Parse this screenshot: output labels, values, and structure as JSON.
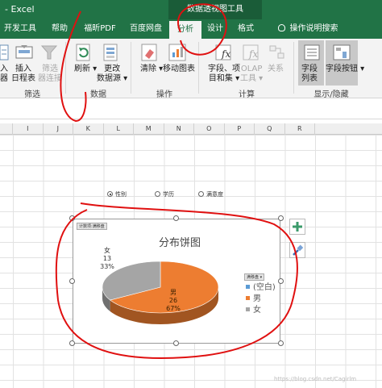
{
  "titlebar": {
    "app": "- Excel",
    "context_tools": "数据透视图工具"
  },
  "tabs": [
    "开发工具",
    "帮助",
    "福昕PDF",
    "百度网盘",
    "分析",
    "设计",
    "格式",
    "操作说明搜索"
  ],
  "ribbon": {
    "filter_group": {
      "label": "筛选",
      "insert_slicer_partial": "入",
      "slicer_partial": "器",
      "insert_timeline": [
        "插入",
        "日程表"
      ],
      "filter_connections": [
        "筛选",
        "器连接"
      ]
    },
    "data_group": {
      "label": "数据",
      "refresh": "刷新",
      "change_source": [
        "更改",
        "数据源"
      ]
    },
    "actions_group": {
      "label": "操作",
      "clear": "清除",
      "move_chart": "移动图表"
    },
    "calc_group": {
      "label": "计算",
      "fields_items": [
        "字段、项",
        "目和集"
      ],
      "olap_tools": [
        "OLAP",
        "工具"
      ],
      "relationships": "关系"
    },
    "showhide_group": {
      "label": "显示/隐藏",
      "field_list": [
        "字段",
        "列表"
      ],
      "field_buttons": "字段按钮"
    }
  },
  "columns": [
    "I",
    "J",
    "K",
    "L",
    "M",
    "N",
    "O",
    "P",
    "Q",
    "R"
  ],
  "slicer_radios": [
    {
      "label": "性别",
      "selected": true
    },
    {
      "label": "学历",
      "selected": false
    },
    {
      "label": "满意度",
      "selected": false
    }
  ],
  "chart_data": {
    "type": "pie",
    "title": "分布饼图",
    "value_field_button": "计数项:满移盘",
    "axis_field_button": "满移盘",
    "categories": [
      "(空白)",
      "男",
      "女"
    ],
    "values": [
      0,
      26,
      13
    ],
    "percent_labels": [
      "",
      "67%",
      "33%"
    ],
    "colors": [
      "#5b9bd5",
      "#ed7d31",
      "#a5a5a5"
    ],
    "legend_position": "right"
  },
  "watermark": "https://blog.csdn.net/Cagirlm"
}
